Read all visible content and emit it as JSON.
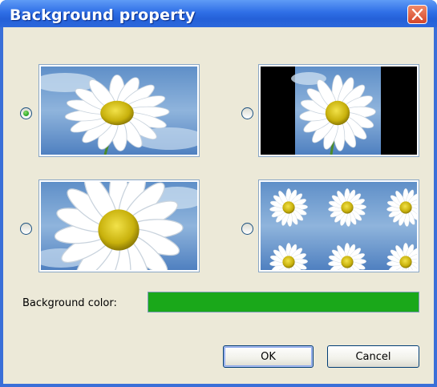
{
  "dialog": {
    "title": "Background property",
    "close_icon": "close-icon"
  },
  "layout_options": [
    {
      "mode": "stretch",
      "selected": true,
      "icon": "daisy-thumbnail"
    },
    {
      "mode": "center",
      "selected": false,
      "icon": "daisy-thumbnail"
    },
    {
      "mode": "zoom",
      "selected": false,
      "icon": "daisy-thumbnail"
    },
    {
      "mode": "tile",
      "selected": false,
      "icon": "daisy-thumbnail"
    }
  ],
  "background_color": {
    "label": "Background color:",
    "value": "#1aa81a"
  },
  "buttons": {
    "ok": "OK",
    "cancel": "Cancel"
  },
  "colors": {
    "titlebar": "#2f6fe6",
    "dialog_background": "#ece9d8",
    "selected_radio": "#21a121"
  }
}
